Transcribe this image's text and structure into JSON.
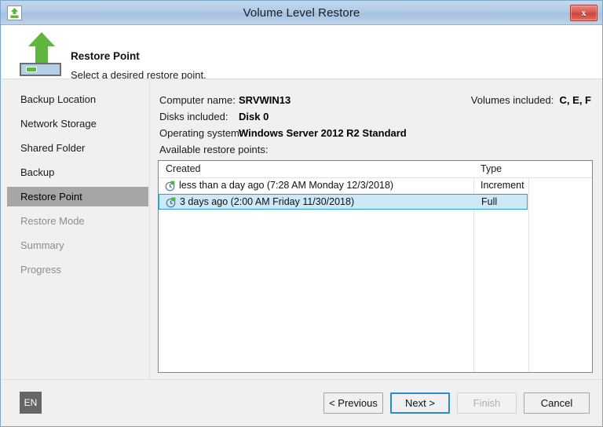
{
  "window": {
    "title": "Volume Level Restore",
    "app_icon": "upload-restore-icon",
    "close_label": "x"
  },
  "header": {
    "title": "Restore Point",
    "subtitle": "Select a desired restore point.",
    "logo": "green-up-arrow-icon"
  },
  "sidebar": {
    "items": [
      {
        "label": "Backup Location",
        "state": "normal"
      },
      {
        "label": "Network Storage",
        "state": "normal"
      },
      {
        "label": "Shared Folder",
        "state": "normal"
      },
      {
        "label": "Backup",
        "state": "normal"
      },
      {
        "label": "Restore Point",
        "state": "active"
      },
      {
        "label": "Restore Mode",
        "state": "disabled"
      },
      {
        "label": "Summary",
        "state": "disabled"
      },
      {
        "label": "Progress",
        "state": "disabled"
      }
    ]
  },
  "main": {
    "computer_name_label": "Computer name:",
    "computer_name_value": "SRVWIN13",
    "disks_included_label": "Disks included:",
    "disks_included_value": "Disk 0",
    "operating_system_label": "Operating system:",
    "operating_system_value": "Windows Server 2012 R2 Standard",
    "volumes_included_label": "Volumes included:",
    "volumes_included_value": "C, E, F",
    "available_restore_points_label": "Available restore points:",
    "table": {
      "columns": [
        "Created",
        "Type"
      ],
      "rows": [
        {
          "icon": "restore-point-clock-icon",
          "created": "less than a day ago (7:28 AM Monday 12/3/2018)",
          "type": "Increment",
          "selected": false
        },
        {
          "icon": "restore-point-clock-icon",
          "created": "3 days ago (2:00 AM Friday 11/30/2018)",
          "type": "Full",
          "selected": true
        }
      ]
    }
  },
  "footer": {
    "language_badge": "EN",
    "previous_label": "< Previous",
    "next_label": "Next >",
    "finish_label": "Finish",
    "cancel_label": "Cancel"
  },
  "colors": {
    "titlebar_top": "#c3d7ec",
    "titlebar_bottom": "#bdd3e9",
    "accent_green": "#5fb53d",
    "selection_blue": "#cde8f7",
    "selection_border": "#26a0da",
    "focus_border": "#2a8bd0",
    "nav_active": "#a6a6a6",
    "close_red": "#d9594c"
  }
}
